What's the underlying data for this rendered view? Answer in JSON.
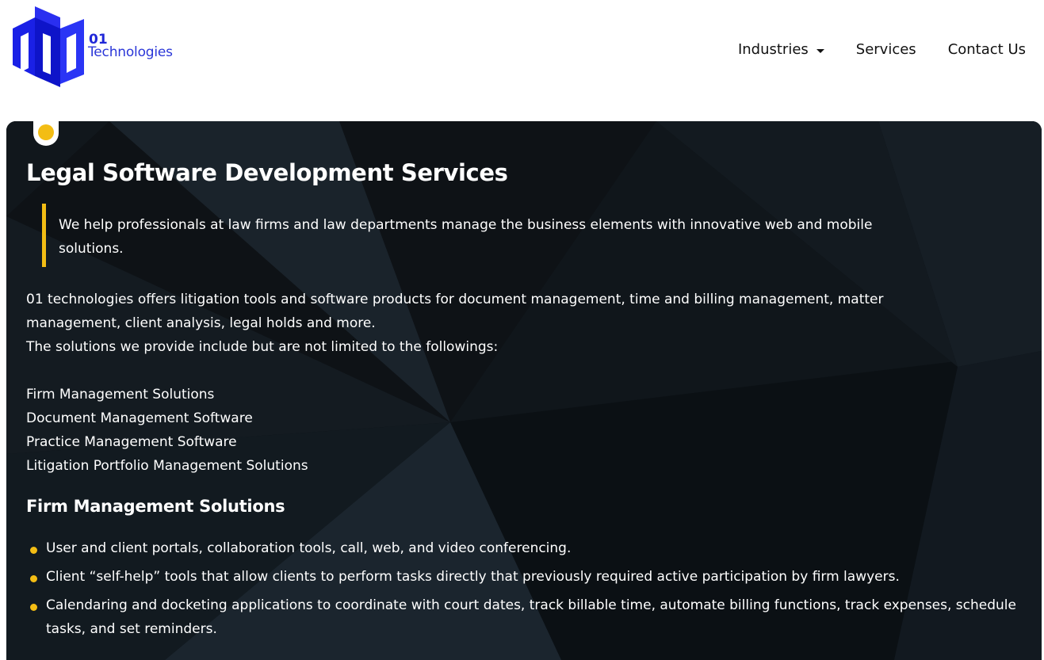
{
  "header": {
    "logo": {
      "number": "01",
      "word": "Technologies"
    },
    "nav": [
      {
        "label": "Industries",
        "has_dropdown": true
      },
      {
        "label": "Services",
        "has_dropdown": false
      },
      {
        "label": "Contact Us",
        "has_dropdown": false
      }
    ]
  },
  "main": {
    "title": "Legal Software Development Services",
    "quote": "We help professionals at law firms and law departments manage the business elements with innovative web and mobile solutions.",
    "intro": [
      "01 technologies offers litigation tools and software products for document management, time and billing management, matter management, client analysis, legal holds and more.",
      "The solutions we provide include but are not limited to the followings:"
    ],
    "solutions": [
      "Firm Management Solutions",
      "Document Management Software",
      "Practice Management Software",
      "Litigation Portfolio Management Solutions"
    ],
    "section_heading": "Firm Management Solutions",
    "bullets": [
      "User and client portals, collaboration tools, call, web, and video conferencing.",
      "Client “self-help” tools that allow clients to perform tasks directly that previously required active participation by firm lawyers.",
      "Calendaring and docketing applications to coordinate with court dates, track billable time, automate billing functions, track expenses, schedule tasks, and set reminders."
    ]
  },
  "colors": {
    "accent": "#f3bd14",
    "brand": "#1f27d8",
    "panel_bg": "#0e1216",
    "text_light": "#ffffff",
    "text_dark": "#111111"
  }
}
